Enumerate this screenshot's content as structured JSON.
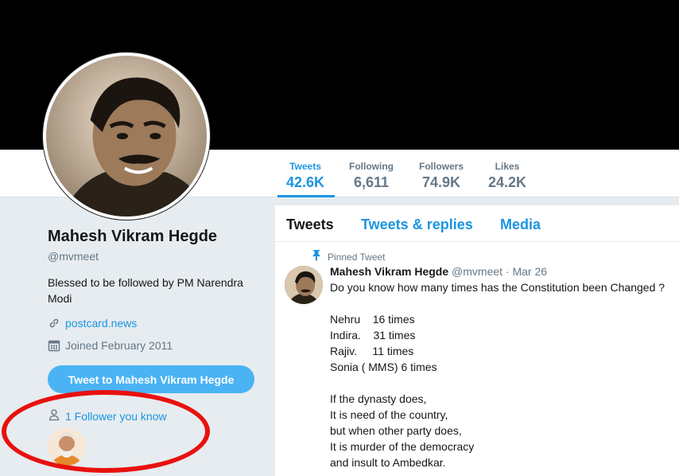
{
  "profile": {
    "name": "Mahesh Vikram Hegde",
    "handle": "@mvmeet",
    "bio": "Blessed to be followed by PM Narendra Modi",
    "website": "postcard.news",
    "joined": "Joined February 2011",
    "tweet_to_label": "Tweet to Mahesh Vikram Hegde",
    "followers_you_know": "1 Follower you know"
  },
  "stats": [
    {
      "label": "Tweets",
      "value": "42.6K",
      "active": true
    },
    {
      "label": "Following",
      "value": "6,611",
      "active": false
    },
    {
      "label": "Followers",
      "value": "74.9K",
      "active": false
    },
    {
      "label": "Likes",
      "value": "24.2K",
      "active": false
    }
  ],
  "timeline": {
    "tabs": [
      {
        "label": "Tweets",
        "active": true
      },
      {
        "label": "Tweets & replies",
        "active": false
      },
      {
        "label": "Media",
        "active": false
      }
    ],
    "pinned_label": "Pinned Tweet",
    "tweet": {
      "author": "Mahesh Vikram Hegde",
      "handle": "@mvmeet",
      "separator": "·",
      "date": "Mar 26",
      "lines": [
        "Do you know how many times has the Constitution been Changed ?",
        "",
        "Nehru    16 times",
        "Indira.    31 times",
        "Rajiv.     11 times",
        "Sonia ( MMS) 6 times",
        "",
        "If the dynasty does,",
        "It is need of the country,",
        "but when other party does,",
        "It is murder of the democracy",
        "and insult to Ambedkar."
      ]
    }
  },
  "colors": {
    "accent": "#1b95e0",
    "button": "#4ab3f4",
    "annotation": "#e8110f",
    "banner": "#000000",
    "page_bg": "#e6ecf0"
  },
  "icons": [
    "link-icon",
    "calendar-icon",
    "person-icon",
    "pin-icon"
  ]
}
